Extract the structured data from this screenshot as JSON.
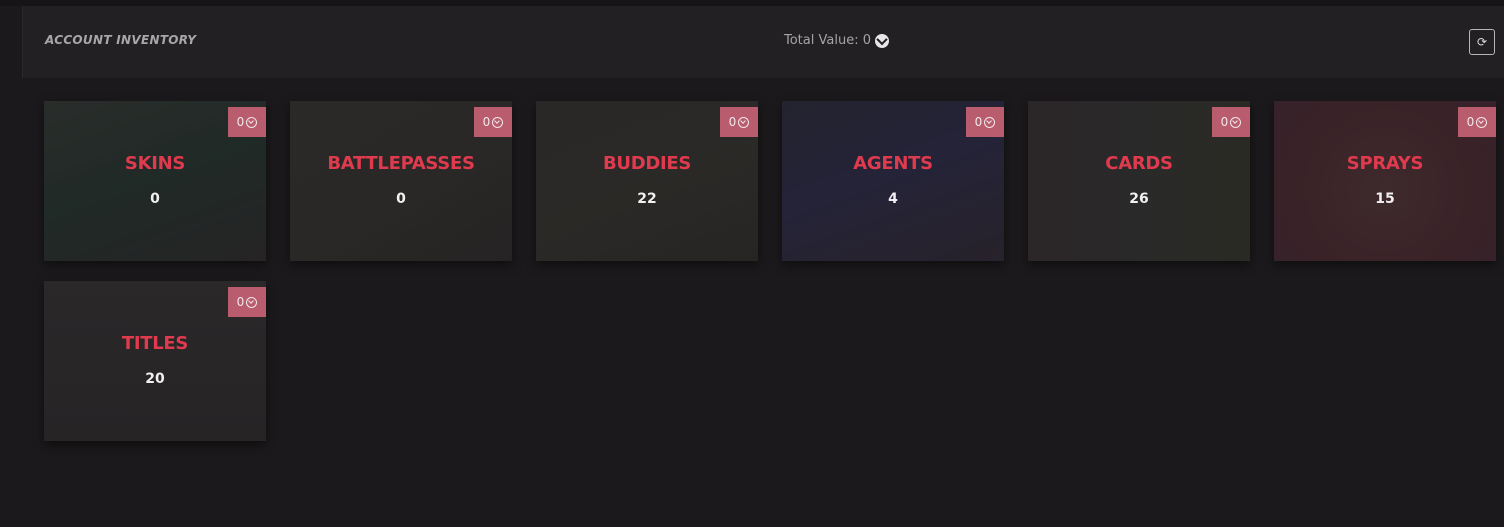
{
  "header": {
    "title": "ACCOUNT INVENTORY",
    "total_value_label": "Total Value: 0",
    "refresh_icon": "refresh-icon"
  },
  "categories": [
    {
      "label": "SKINS",
      "count": "0",
      "price": "0"
    },
    {
      "label": "BATTLEPASSES",
      "count": "0",
      "price": "0"
    },
    {
      "label": "BUDDIES",
      "count": "22",
      "price": "0"
    },
    {
      "label": "AGENTS",
      "count": "4",
      "price": "0"
    },
    {
      "label": "CARDS",
      "count": "26",
      "price": "0"
    },
    {
      "label": "SPRAYS",
      "count": "15",
      "price": "0"
    },
    {
      "label": "TITLES",
      "count": "20",
      "price": "0"
    }
  ],
  "colors": {
    "accent": "#e03a4e",
    "badge": "#b95c6e",
    "background": "#1b191b",
    "header": "#222022"
  }
}
